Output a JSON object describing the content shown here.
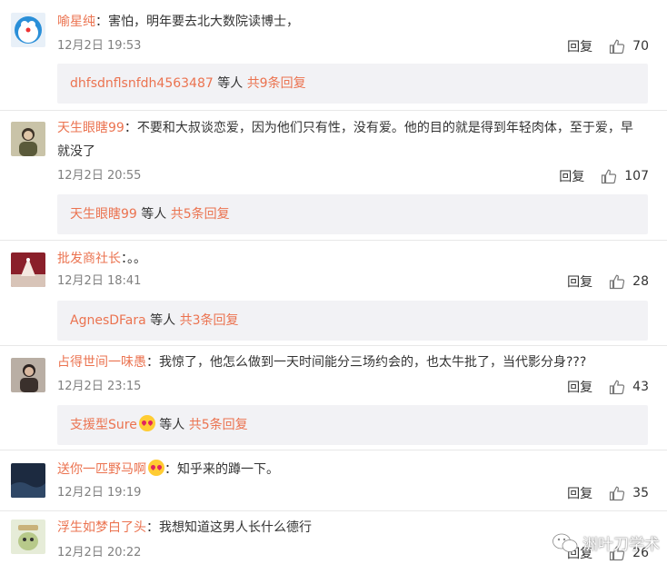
{
  "comments": [
    {
      "user": "喻星纯",
      "text": "：害怕，明年要去北大数院读博士，",
      "time": "12月2日 19:53",
      "reply_label": "回复",
      "likes": "70",
      "sub_user": "dhfsdnflsnfdh4563487",
      "sub_mid": " 等人 ",
      "sub_total": "共9条回复"
    },
    {
      "user": "天生眼瞎99",
      "text": "：不要和大叔谈恋爱，因为他们只有性，没有爱。他的目的就是得到年轻肉体，至于爱，早就没了",
      "time": "12月2日 20:55",
      "reply_label": "回复",
      "likes": "107",
      "sub_user": "天生眼瞎99",
      "sub_mid": " 等人 ",
      "sub_total": "共5条回复"
    },
    {
      "user": "批发商社长",
      "text": "：。。",
      "time": "12月2日 18:41",
      "reply_label": "回复",
      "likes": "28",
      "sub_user": "AgnesDFara",
      "sub_mid": " 等人 ",
      "sub_total": "共3条回复"
    },
    {
      "user": "占得世间一味愚",
      "text": "：我惊了，他怎么做到一天时间能分三场约会的，也太牛批了，当代影分身???",
      "time": "12月2日 23:15",
      "reply_label": "回复",
      "likes": "43",
      "sub_user": "支援型Sure",
      "sub_mid": " 等人 ",
      "sub_total": "共5条回复"
    },
    {
      "user": "送你一匹野马啊",
      "text": "：知乎来的蹲一下。",
      "time": "12月2日 19:19",
      "reply_label": "回复",
      "likes": "35"
    },
    {
      "user": "浮生如梦白了头",
      "text": "：我想知道这男人长什么德行",
      "time": "12月2日 20:22",
      "reply_label": "回复",
      "likes": "26"
    }
  ],
  "watermark": "洲叶刀学术",
  "colors": {
    "username": "#eb7350",
    "subbox_bg": "#f2f2f5",
    "meta": "#808080"
  }
}
